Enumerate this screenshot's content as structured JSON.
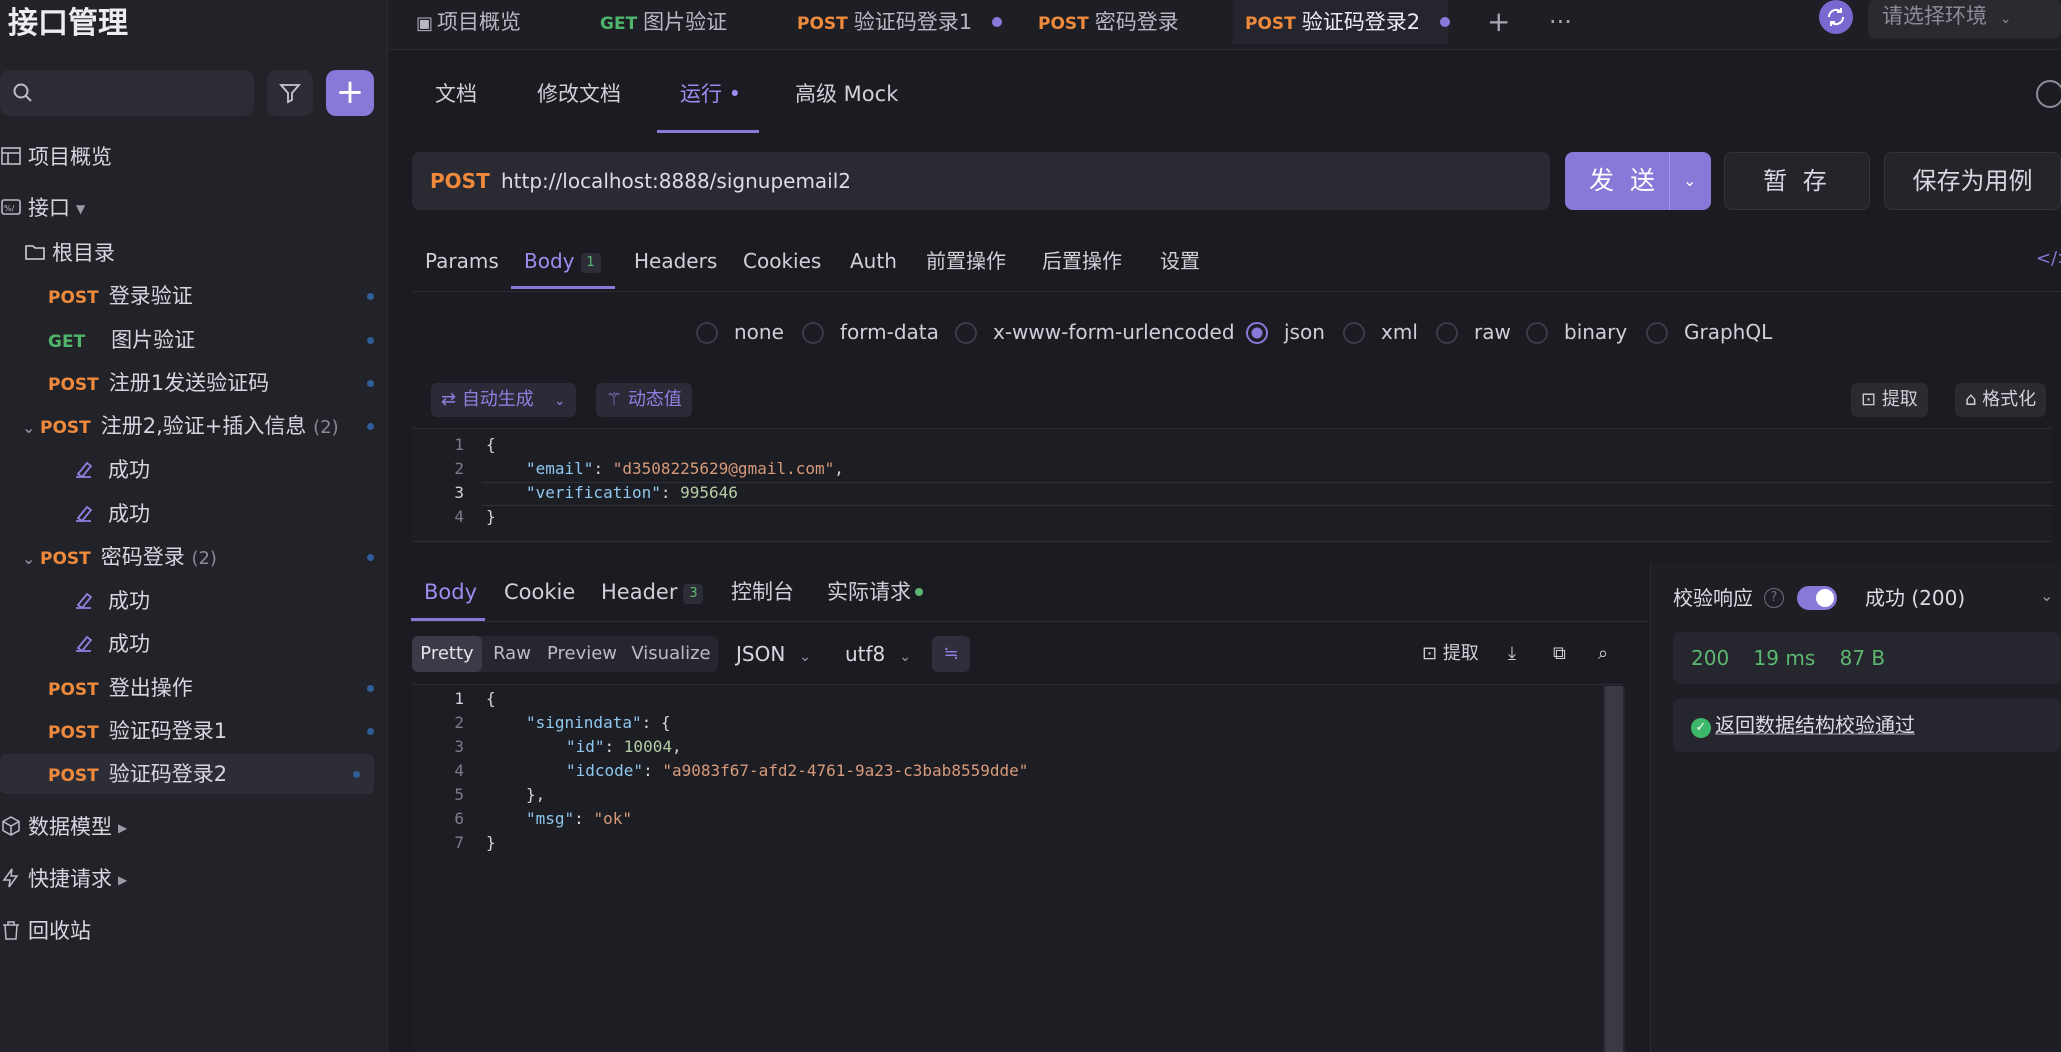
{
  "app": {
    "title": "接口管理"
  },
  "sidebar": {
    "items": [
      {
        "label": "项目概览"
      },
      {
        "label": "接口"
      },
      {
        "label": "根目录"
      },
      {
        "method": "POST",
        "label": "登录验证"
      },
      {
        "method": "GET",
        "label": "图片验证"
      },
      {
        "method": "POST",
        "label": "注册1发送验证码"
      },
      {
        "method": "POST",
        "label": "注册2,验证+插入信息",
        "count": "(2)"
      },
      {
        "label": "成功"
      },
      {
        "label": "成功"
      },
      {
        "method": "POST",
        "label": "密码登录",
        "count": "(2)"
      },
      {
        "label": "成功"
      },
      {
        "label": "成功"
      },
      {
        "method": "POST",
        "label": "登出操作"
      },
      {
        "method": "POST",
        "label": "验证码登录1"
      },
      {
        "method": "POST",
        "label": "验证码登录2"
      },
      {
        "label": "数据模型"
      },
      {
        "label": "快捷请求"
      },
      {
        "label": "回收站"
      }
    ]
  },
  "top_tabs": [
    {
      "label": "项目概览"
    },
    {
      "method": "GET",
      "label": "图片验证"
    },
    {
      "method": "POST",
      "label": "验证码登录1"
    },
    {
      "method": "POST",
      "label": "密码登录"
    },
    {
      "method": "POST",
      "label": "验证码登录2"
    }
  ],
  "environment": {
    "placeholder": "请选择环境"
  },
  "sub_tabs": [
    "文档",
    "修改文档",
    "运行 •",
    "高级 Mock"
  ],
  "request": {
    "method": "POST",
    "url": "http://localhost:8888/signupemail2",
    "send_label": "发 送",
    "save_label": "暂 存",
    "save_case_label": "保存为用例"
  },
  "request_tabs": [
    {
      "label": "Params"
    },
    {
      "label": "Body",
      "badge": "1"
    },
    {
      "label": "Headers"
    },
    {
      "label": "Cookies"
    },
    {
      "label": "Auth"
    },
    {
      "label": "前置操作"
    },
    {
      "label": "后置操作"
    },
    {
      "label": "设置"
    }
  ],
  "body_types": [
    "none",
    "form-data",
    "x-www-form-urlencoded",
    "json",
    "xml",
    "raw",
    "binary",
    "GraphQL"
  ],
  "body_type_selected": "json",
  "editor_toolbar": {
    "auto_generate": "自动生成",
    "dynamic_value": "动态值",
    "extract": "提取",
    "format": "格式化"
  },
  "request_body": {
    "line_numbers": [
      "1",
      "2",
      "3",
      "4"
    ],
    "email_key": "\"email\"",
    "email_value": "\"d3508225629@gmail.com\"",
    "verification_key": "\"verification\"",
    "verification_value": "995646"
  },
  "response_tabs": [
    {
      "label": "Body"
    },
    {
      "label": "Cookie"
    },
    {
      "label": "Header",
      "badge": "3"
    },
    {
      "label": "控制台"
    },
    {
      "label": "实际请求"
    }
  ],
  "response_formats": [
    "Pretty",
    "Raw",
    "Preview",
    "Visualize"
  ],
  "response_lang": "JSON",
  "response_encoding": "utf8",
  "response_tools": {
    "extract": "提取"
  },
  "response_body": {
    "line_numbers": [
      "1",
      "2",
      "3",
      "4",
      "5",
      "6",
      "7"
    ],
    "signindata_key": "\"signindata\"",
    "id_key": "\"id\"",
    "id_value": "10004",
    "idcode_key": "\"idcode\"",
    "idcode_value": "\"a9083f67-afd2-4761-9a23-c3bab8559dde\"",
    "msg_key": "\"msg\"",
    "msg_value": "\"ok\""
  },
  "validation": {
    "label": "校验响应",
    "status": "成功 (200)",
    "status_code": "200",
    "time": "19 ms",
    "size": "87 B",
    "result": "返回数据结构校验通过",
    "enabled": true
  },
  "colors": {
    "accent": "#8a78d8",
    "post": "#ef8a3c",
    "get": "#4fb56a",
    "success": "#5cb870",
    "background": "#1b1b22"
  },
  "icons": [
    "search-icon",
    "filter-icon",
    "plus-icon",
    "overview-icon",
    "api-icon",
    "folder-icon",
    "case-icon",
    "model-icon",
    "shortcut-icon",
    "trash-icon",
    "sync-icon",
    "more-icon",
    "download-icon",
    "copy-icon",
    "zoom-icon",
    "check-icon"
  ]
}
